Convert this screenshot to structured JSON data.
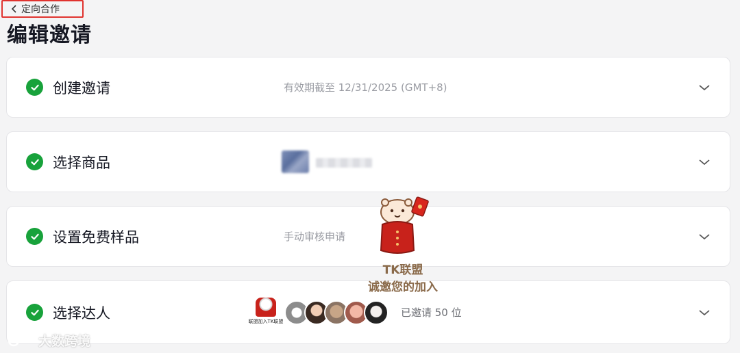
{
  "header": {
    "back_label": "定向合作",
    "title": "编辑邀请"
  },
  "steps": [
    {
      "label": "创建邀请",
      "detail": "有效期截至 12/31/2025 (GMT+8)",
      "status": "completed"
    },
    {
      "label": "选择商品",
      "detail": "",
      "status": "completed"
    },
    {
      "label": "设置免费样品",
      "detail": "手动审核申请",
      "status": "completed"
    },
    {
      "label": "选择达人",
      "detail": "已邀请 50 位",
      "status": "completed"
    }
  ],
  "creators": {
    "mini_logo_caption": "联盟加入TK联盟",
    "avatar_count_shown": 5
  },
  "watermark": {
    "line1": "TK联盟",
    "line2": "诚邀您的加入",
    "corner_text": "大数跨境"
  },
  "colors": {
    "check_green": "#18a23b",
    "highlight_red": "#e0332f",
    "background": "#f4f4f5"
  },
  "icons": {
    "back": "chevron-left-icon",
    "check": "check-circle-icon",
    "expand": "chevron-down-icon"
  }
}
